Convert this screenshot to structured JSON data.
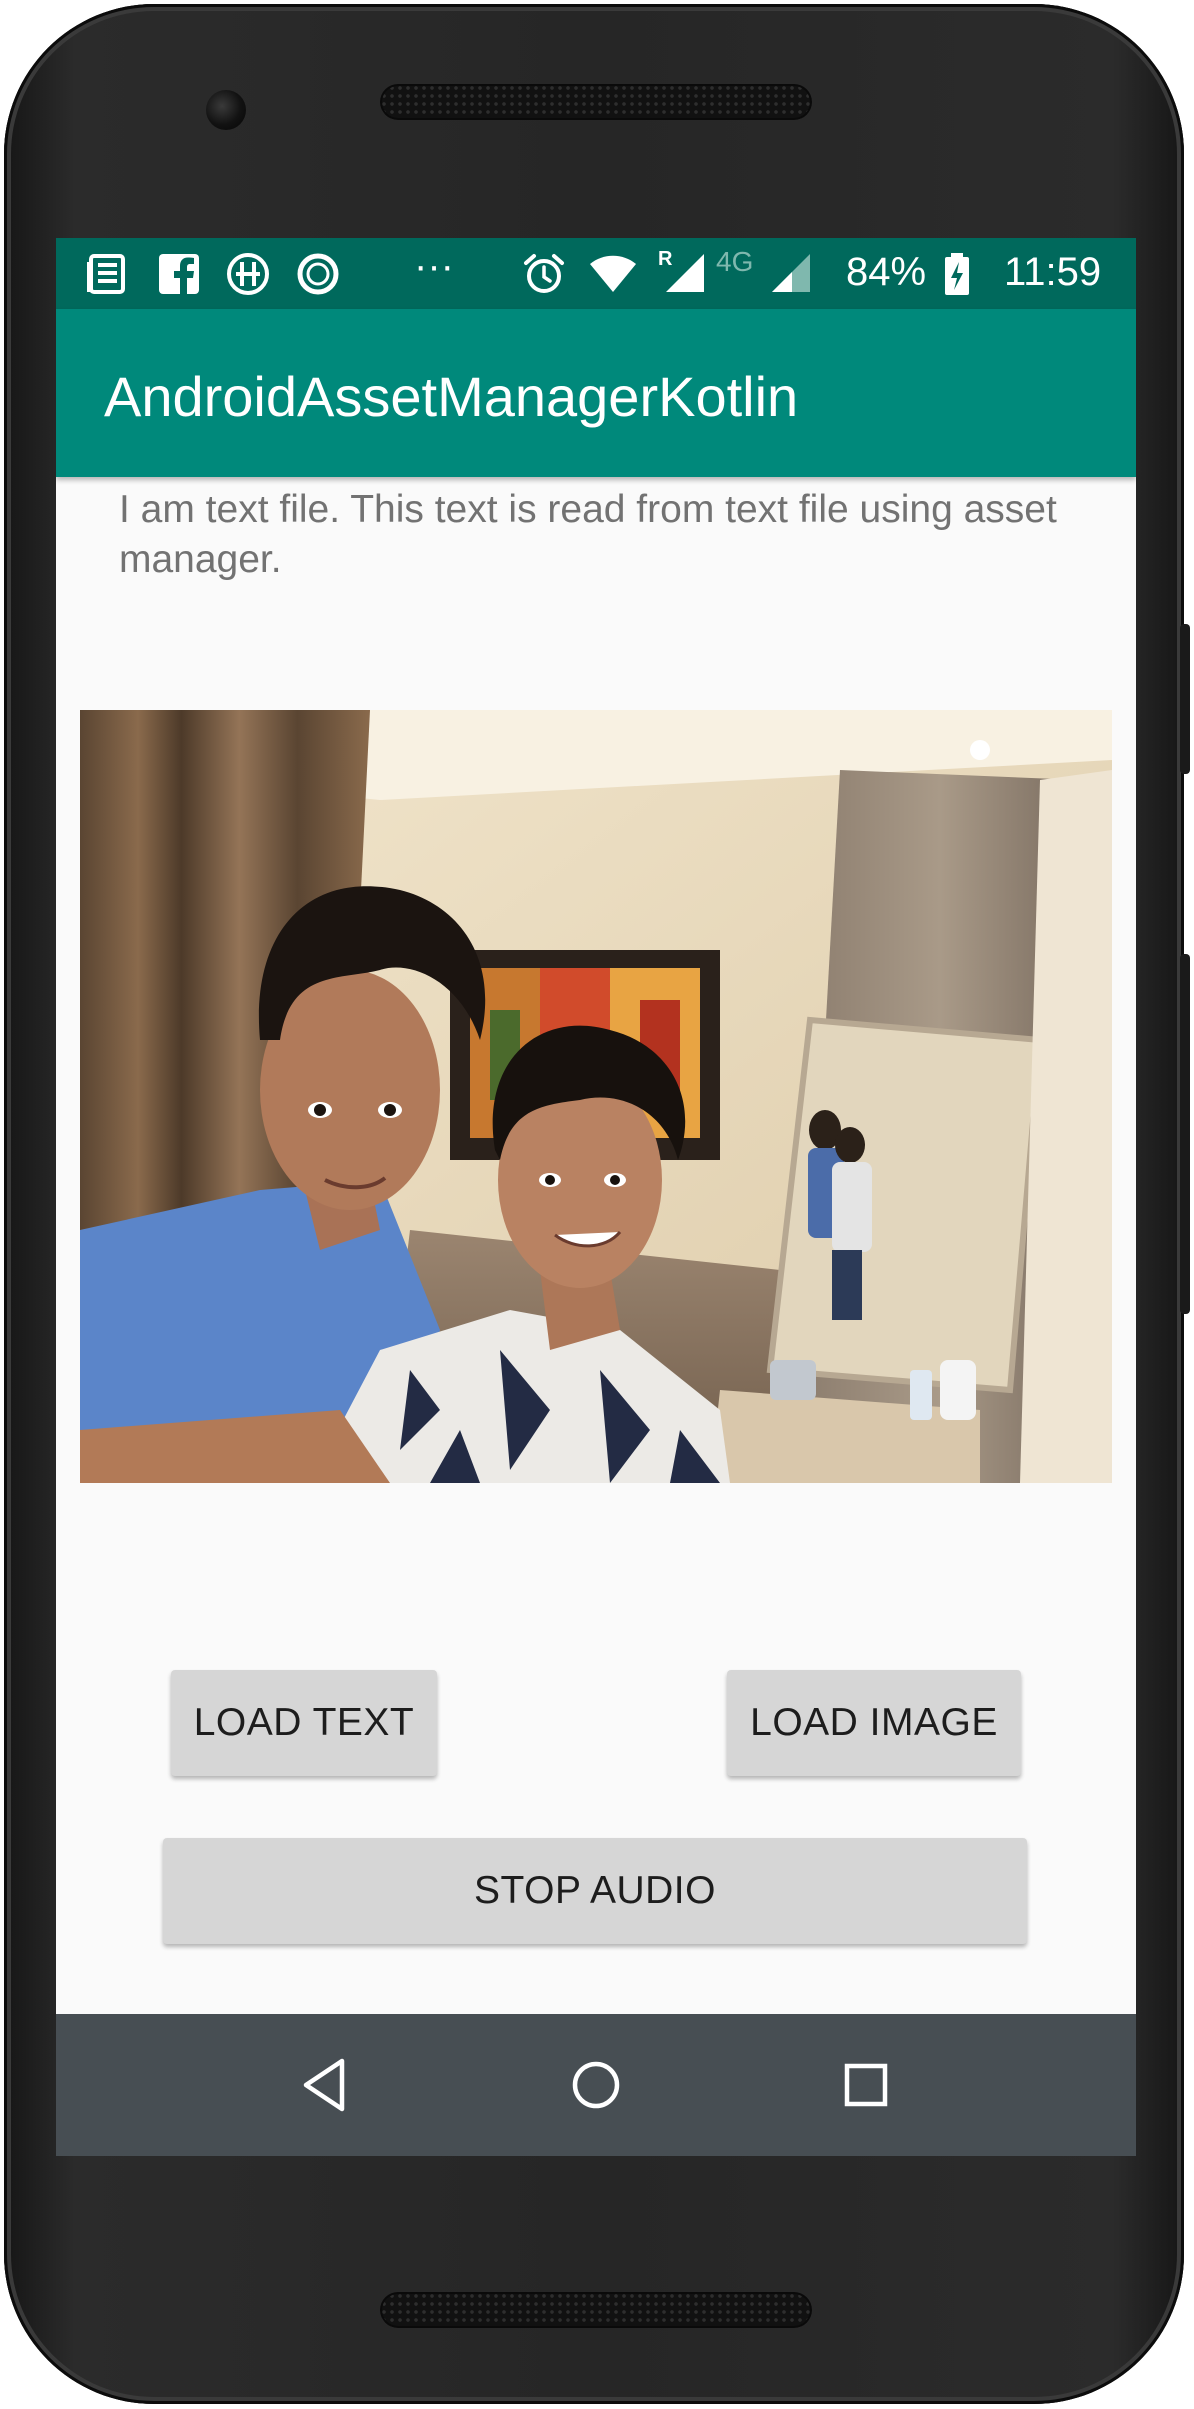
{
  "status_bar": {
    "notification_icons": [
      "news-icon",
      "facebook-icon",
      "hike-icon",
      "circle-app-icon"
    ],
    "more": "···",
    "battery": "84%",
    "time": "11:59",
    "network": "4G",
    "roaming": "R"
  },
  "app_bar": {
    "title": "AndroidAssetManagerKotlin"
  },
  "main": {
    "text_content": "I am text file. This text is read from text file using asset manager.",
    "image_description": "selfie-photo"
  },
  "buttons": {
    "load_text": "LOAD TEXT",
    "load_image": "LOAD IMAGE",
    "stop_audio": "STOP AUDIO"
  },
  "nav_bar": {
    "icons": [
      "back-icon",
      "home-icon",
      "recents-icon"
    ]
  },
  "colors": {
    "status_bar": "#00695c",
    "app_bar": "#00897b",
    "background": "#fafafa",
    "button": "#d6d6d6",
    "nav_bar": "#474e53"
  }
}
